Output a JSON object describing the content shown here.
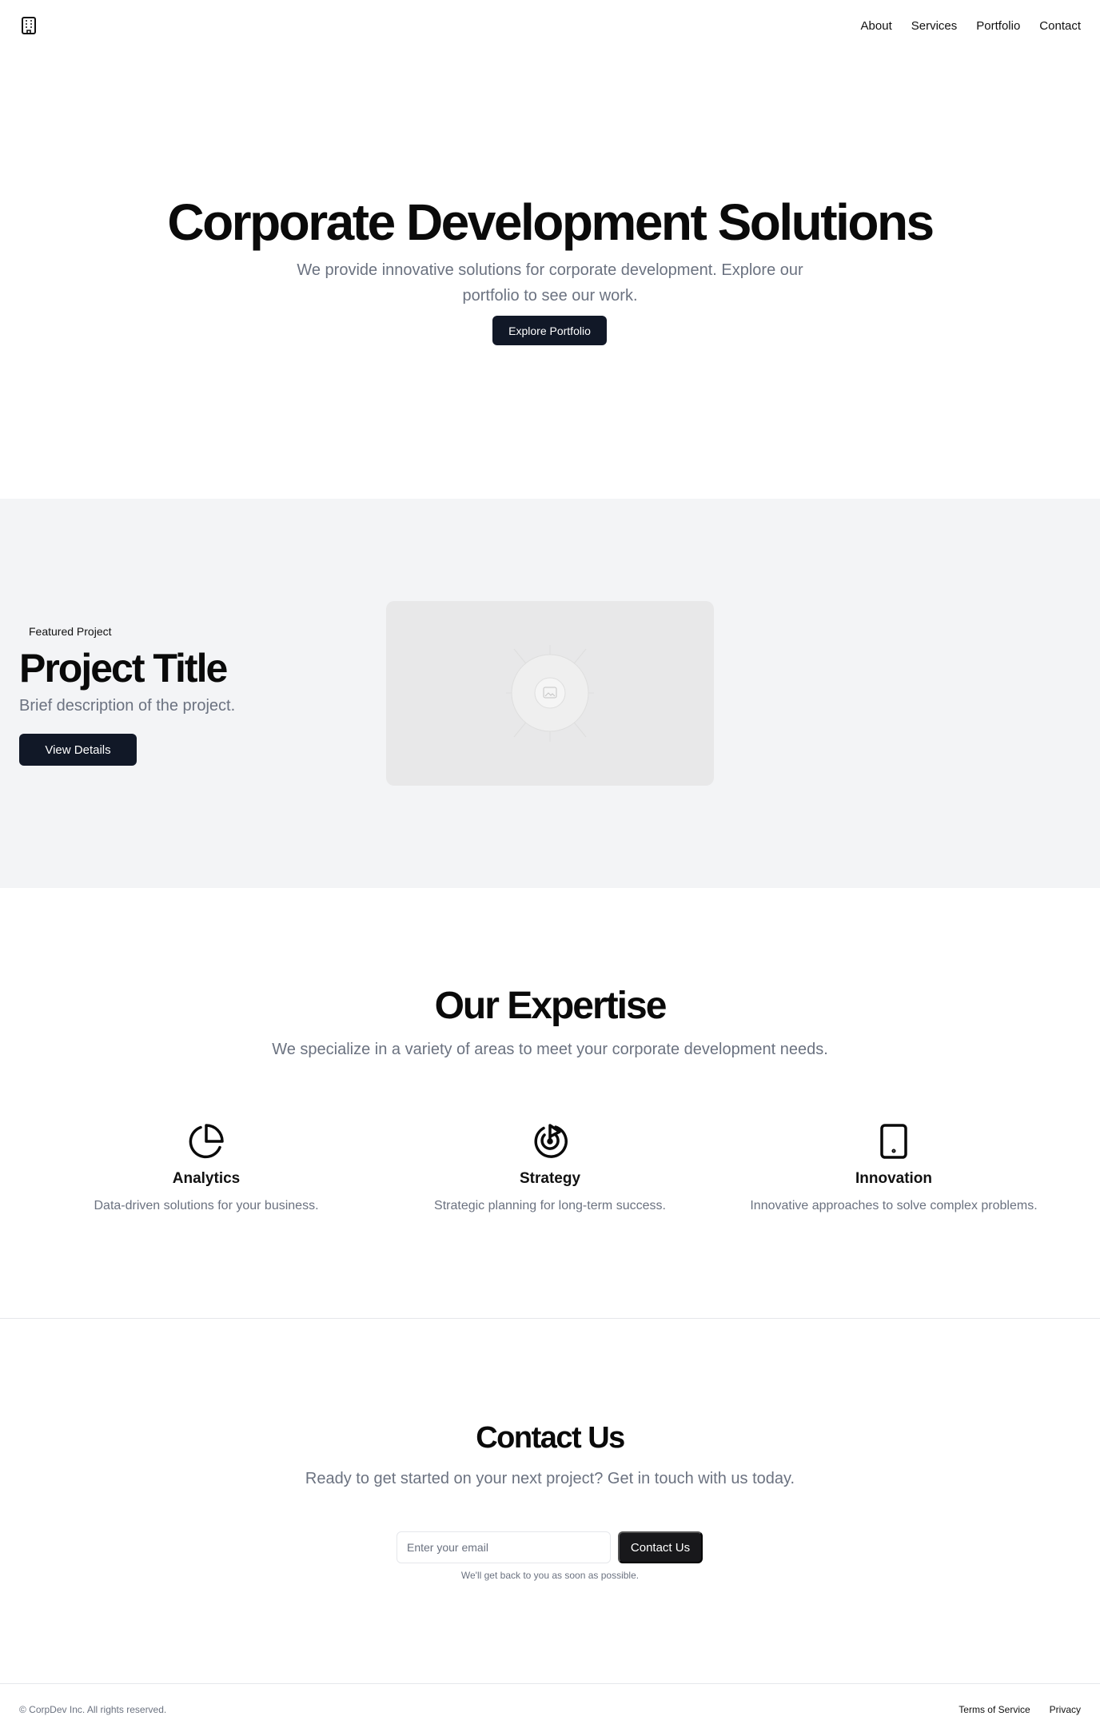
{
  "header": {
    "logo_icon": "building-icon",
    "nav": [
      {
        "label": "About"
      },
      {
        "label": "Services"
      },
      {
        "label": "Portfolio"
      },
      {
        "label": "Contact"
      }
    ]
  },
  "hero": {
    "title": "Corporate Development Solutions",
    "subtitle": "We provide innovative solutions for corporate development. Explore our portfolio to see our work.",
    "cta": "Explore Portfolio"
  },
  "featured": {
    "tag": "Featured Project",
    "title": "Project Title",
    "description": "Brief description of the project.",
    "cta": "View Details",
    "image_icon": "image-placeholder-icon"
  },
  "expertise": {
    "title": "Our Expertise",
    "subtitle": "We specialize in a variety of areas to meet your corporate development needs.",
    "items": [
      {
        "icon": "pie-chart-icon",
        "title": "Analytics",
        "text": "Data-driven solutions for your business."
      },
      {
        "icon": "target-icon",
        "title": "Strategy",
        "text": "Strategic planning for long-term success."
      },
      {
        "icon": "tablet-icon",
        "title": "Innovation",
        "text": "Innovative approaches to solve complex problems."
      }
    ]
  },
  "contact": {
    "title": "Contact Us",
    "subtitle": "Ready to get started on your next project? Get in touch with us today.",
    "email_placeholder": "Enter your email",
    "button": "Contact Us",
    "note": "We'll get back to you as soon as possible."
  },
  "footer": {
    "copyright": "© CorpDev Inc. All rights reserved.",
    "links": [
      {
        "label": "Terms of Service"
      },
      {
        "label": "Privacy"
      }
    ]
  },
  "colors": {
    "primary_button": "#111827",
    "contact_button": "#18181b",
    "muted_text": "#6b7280",
    "section_background": "#f3f4f6"
  }
}
